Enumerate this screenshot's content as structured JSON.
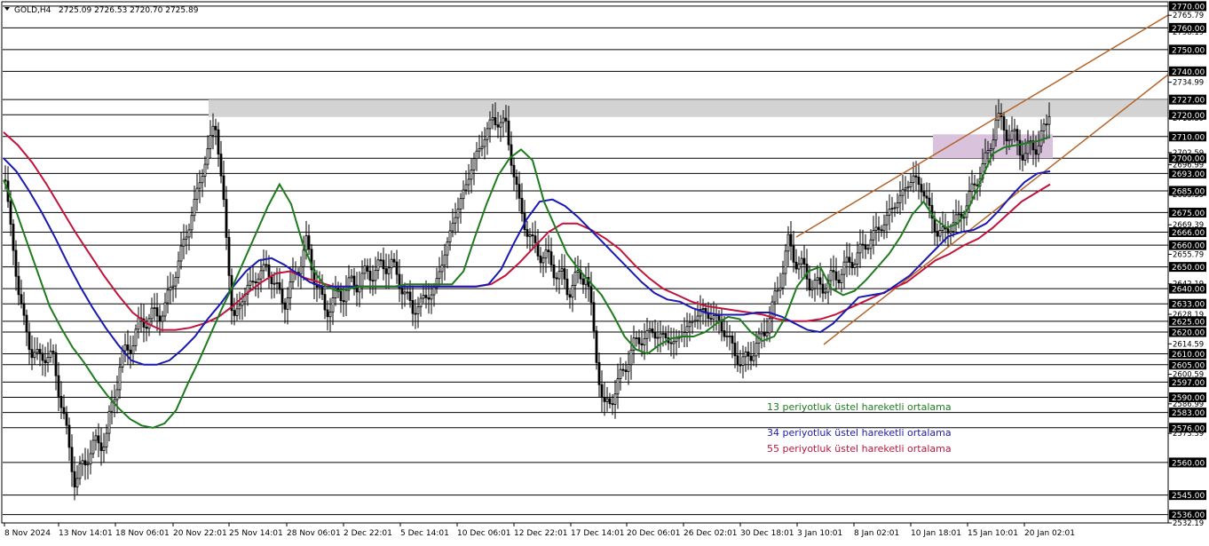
{
  "header": {
    "symbol_timeframe": "GOLD,H4",
    "ohlc": "2725.09 2726.53 2720.70 2725.89",
    "menu_icon": "triangle-down-icon"
  },
  "colors": {
    "background": "#ffffff",
    "grid_line": "#000000",
    "candle": "#000000",
    "ema13": "#1e7b1e",
    "ema34": "#1a1ab0",
    "ema55": "#c0143c",
    "trendline": "#b5652b",
    "resistance_zone": "#d3d3d3",
    "consolidation_box": "#d8c2dc",
    "price_tag_bg": "#000000",
    "price_tag_text": "#ffffff"
  },
  "chart_data": {
    "type": "candlestick",
    "symbol": "GOLD",
    "timeframe": "H4",
    "ylim": [
      2532.19,
      2772
    ],
    "x_labels": [
      "8 Nov 2024",
      "13 Nov 14:01",
      "18 Nov 06:01",
      "20 Nov 22:01",
      "25 Nov 14:01",
      "28 Nov 06:01",
      "2 Dec 22:01",
      "5 Dec 14:01",
      "10 Dec 06:01",
      "12 Dec 22:01",
      "17 Dec 14:01",
      "20 Dec 06:01",
      "26 Dec 02:01",
      "30 Dec 18:01",
      "3 Jan 10:01",
      "8 Jan 02:01",
      "10 Jan 18:01",
      "15 Jan 10:01",
      "20 Jan 02:01"
    ],
    "price_levels": [
      2770.0,
      2760.0,
      2750.0,
      2740.0,
      2727.0,
      2720.0,
      2710.0,
      2700.0,
      2693.0,
      2685.0,
      2675.0,
      2666.0,
      2660.0,
      2650.0,
      2640.0,
      2633.0,
      2625.0,
      2620.0,
      2610.0,
      2605.0,
      2597.0,
      2590.0,
      2583.0,
      2576.0,
      2560.0,
      2545.0,
      2536.0
    ],
    "axis_ticks": [
      "2765.79",
      "2758.19",
      "2734.99",
      "2718.39",
      "2702.59",
      "2696.99",
      "2683.39",
      "2669.39",
      "2655.79",
      "2642.19",
      "2628.19",
      "2614.59",
      "2600.59",
      "2586.99",
      "2573.39",
      "2532.19"
    ],
    "indicators": {
      "ema13": [
        2690,
        2677,
        2662,
        2647,
        2632,
        2622,
        2613,
        2606,
        2598,
        2591,
        2585,
        2580,
        2577,
        2576,
        2578,
        2584,
        2596,
        2607,
        2619,
        2631,
        2642,
        2654,
        2666,
        2678,
        2688,
        2679,
        2661,
        2648,
        2641,
        2639,
        2640,
        2641,
        2641,
        2641,
        2641,
        2642,
        2642,
        2642,
        2642,
        2642,
        2648,
        2664,
        2679,
        2692,
        2700,
        2704,
        2699,
        2680,
        2668,
        2656,
        2649,
        2643,
        2637,
        2628,
        2618,
        2612,
        2610,
        2614,
        2617,
        2618,
        2618,
        2620,
        2624,
        2627,
        2626,
        2620,
        2616,
        2618,
        2627,
        2641,
        2648,
        2650,
        2640,
        2637,
        2639,
        2644,
        2650,
        2656,
        2664,
        2674,
        2680,
        2672,
        2668,
        2670,
        2678,
        2690,
        2702,
        2705,
        2706,
        2707,
        2708,
        2710
      ],
      "ema34": [
        2700,
        2694,
        2685,
        2675,
        2664,
        2652,
        2641,
        2631,
        2622,
        2614,
        2607,
        2605,
        2605,
        2607,
        2612,
        2618,
        2626,
        2633,
        2641,
        2648,
        2653,
        2654,
        2651,
        2647,
        2643,
        2641,
        2641,
        2641,
        2641,
        2641,
        2641,
        2641,
        2641,
        2641,
        2641,
        2641,
        2641,
        2641,
        2642,
        2649,
        2661,
        2672,
        2680,
        2681,
        2678,
        2673,
        2667,
        2661,
        2655,
        2649,
        2643,
        2638,
        2635,
        2634,
        2631,
        2629,
        2628,
        2628,
        2628,
        2629,
        2629,
        2627,
        2624,
        2621,
        2620,
        2624,
        2630,
        2636,
        2637,
        2638,
        2642,
        2646,
        2652,
        2658,
        2664,
        2666,
        2667,
        2670,
        2676,
        2683,
        2689,
        2693,
        2694
      ],
      "ema55": [
        2712,
        2706,
        2698,
        2688,
        2677,
        2666,
        2656,
        2646,
        2637,
        2629,
        2624,
        2621,
        2621,
        2622,
        2624,
        2627,
        2632,
        2638,
        2643,
        2647,
        2648,
        2645,
        2643,
        2641,
        2641,
        2641,
        2641,
        2641,
        2641,
        2641,
        2641,
        2641,
        2641,
        2641,
        2642,
        2646,
        2652,
        2659,
        2666,
        2670,
        2670,
        2667,
        2663,
        2658,
        2651,
        2645,
        2640,
        2637,
        2634,
        2632,
        2631,
        2630,
        2629,
        2628,
        2626,
        2625,
        2625,
        2626,
        2628,
        2631,
        2634,
        2637,
        2640,
        2643,
        2648,
        2653,
        2656,
        2660,
        2663,
        2668,
        2674,
        2680,
        2684,
        2688
      ]
    },
    "annotations": [
      {
        "type": "resistance_zone",
        "y_range": [
          2719,
          2727
        ]
      },
      {
        "type": "consolidation_box",
        "y_range": [
          2700,
          2711
        ]
      },
      {
        "type": "rising_channel",
        "lines": "upper and lower"
      }
    ]
  },
  "legend": {
    "ema13_label": "13 periyotluk üstel hareketli ortalama",
    "ema34_label": "34 periyotluk üstel hareketli ortalama",
    "ema55_label": "55 periyotluk üstel hareketli ortalama"
  }
}
